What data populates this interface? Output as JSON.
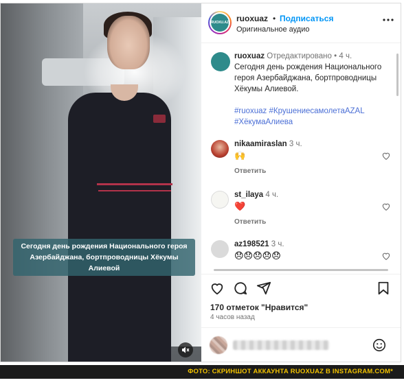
{
  "video": {
    "caption": "Сегодня день рождения Национального героя Азербайджана, бортпроводницы Хёкумы Алиевой",
    "mute_icon": "muted-speaker-icon"
  },
  "header": {
    "username": "ruoxuaz",
    "separator": "•",
    "follow_label": "Подписаться",
    "audio_label": "Оригинальное аудио",
    "more_icon": "more-options-icon"
  },
  "post_caption": {
    "username": "ruoxuaz",
    "edited": "Отредактировано",
    "separator": "•",
    "time": "4 ч.",
    "text": "Сегодня день рождения Национального героя Азербайджана, бортпроводницы Хёкумы Алиевой.",
    "hashtags": "#ruoxuaz #КрушениесамолетаAZAL #ХёкумаАлиева"
  },
  "comments": [
    {
      "username": "nikaamiraslan",
      "time": "3 ч.",
      "body": "🙌",
      "reply_label": "Ответить"
    },
    {
      "username": "st_ilaya",
      "time": "4 ч.",
      "body": "❤️",
      "reply_label": "Ответить"
    },
    {
      "username": "az198521",
      "time": "3 ч.",
      "body": "😞😞😞😞😞"
    }
  ],
  "actions": {
    "like_icon": "heart-icon",
    "comment_icon": "comment-icon",
    "share_icon": "share-icon",
    "save_icon": "bookmark-icon"
  },
  "likes_text": "170 отметок \"Нравится\"",
  "posted_time": "4 часов назад",
  "footer": {
    "credit": "ФОТО: СКРИНШОТ АККАУНТА RUOXUAZ В INSTAGRAM.COM*"
  },
  "colors": {
    "link": "#0095f6",
    "hashtag": "#4b6fd6",
    "footer_bg": "#1b1b1b",
    "footer_text": "#f2c200"
  }
}
